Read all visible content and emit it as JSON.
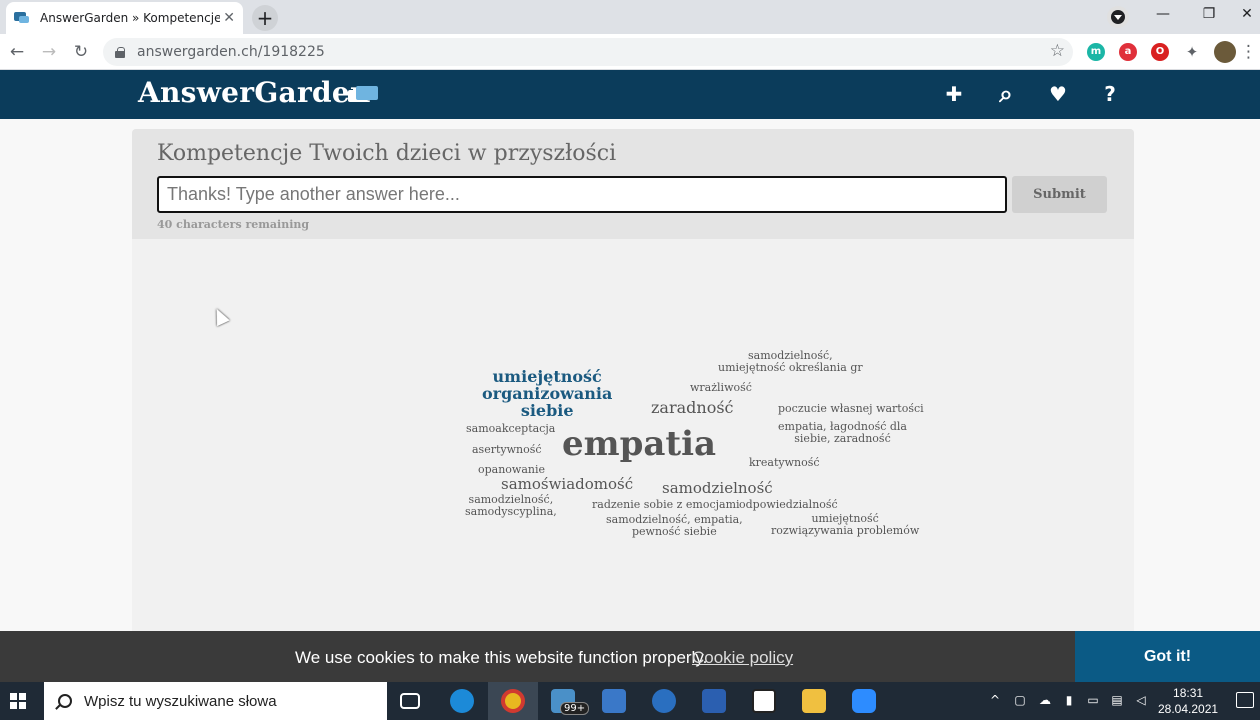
{
  "browser": {
    "tab_title": "AnswerGarden » Kompetencje Twoich dzieci w przyszłości",
    "tab_close": "✕",
    "new_tab": "+",
    "url": "answergarden.ch/1918225",
    "back": "←",
    "forward": "→",
    "reload": "↻",
    "bookmark": "☆",
    "minimize": "—",
    "restore": "❐",
    "close": "✕",
    "menu": "⋮"
  },
  "site": {
    "logo_text": "AnswerGarden",
    "nav": {
      "add": "✚",
      "search": "⌕",
      "heart": "♥",
      "help": "?"
    }
  },
  "garden": {
    "question": "Kompetencje Twoich dzieci w przyszłości",
    "input_placeholder": "Thanks! Type another answer here...",
    "input_value": "",
    "submit_label": "Submit",
    "remaining": "40 characters remaining"
  },
  "cloud": [
    {
      "id": "w1",
      "text": "samodzielność,\numiejętność określania gr",
      "color": "#555555"
    },
    {
      "id": "w2",
      "text": "umiejętność\norganizowania\nsiebie",
      "color": "#1b5a80"
    },
    {
      "id": "w3",
      "text": "wrażliwość",
      "color": "#555555"
    },
    {
      "id": "w4",
      "text": "zaradność",
      "color": "#555555"
    },
    {
      "id": "w5",
      "text": "poczucie własnej wartości",
      "color": "#555555"
    },
    {
      "id": "w6",
      "text": "samoakceptacja",
      "color": "#555555"
    },
    {
      "id": "w7",
      "text": "empatia, łagodność dla\nsiebie, zaradność",
      "color": "#555555"
    },
    {
      "id": "w8",
      "text": "asertywność",
      "color": "#555555"
    },
    {
      "id": "w9",
      "text": "empatia",
      "color": "#555555"
    },
    {
      "id": "w10",
      "text": "kreatywność",
      "color": "#555555"
    },
    {
      "id": "w11",
      "text": "opanowanie",
      "color": "#555555"
    },
    {
      "id": "w12",
      "text": "samoświadomość",
      "color": "#555555"
    },
    {
      "id": "w13",
      "text": "samodzielność",
      "color": "#555555"
    },
    {
      "id": "w14",
      "text": "samodzielność,\nsamodyscyplina,",
      "color": "#555555"
    },
    {
      "id": "w15",
      "text": "radzenie sobie z emocjami",
      "color": "#555555"
    },
    {
      "id": "w16",
      "text": "odpowiedzialność",
      "color": "#555555"
    },
    {
      "id": "w17",
      "text": "samodzielność, empatia,\npewność siebie",
      "color": "#555555"
    },
    {
      "id": "w18",
      "text": "umiejętność\nrozwiązywania problemów",
      "color": "#555555"
    }
  ],
  "cookie": {
    "text": "We use cookies to make this website function properly.",
    "link": "Cookie policy",
    "button": "Got it!"
  },
  "taskbar": {
    "search_placeholder": "Wpisz tu wyszukiwane słowa",
    "mail_badge": "99+",
    "time": "18:31",
    "date": "28.04.2021"
  },
  "colors": {
    "header": "#0b3c5b",
    "accent_word": "#1b5a80",
    "cookie_button": "#0b5a85"
  }
}
